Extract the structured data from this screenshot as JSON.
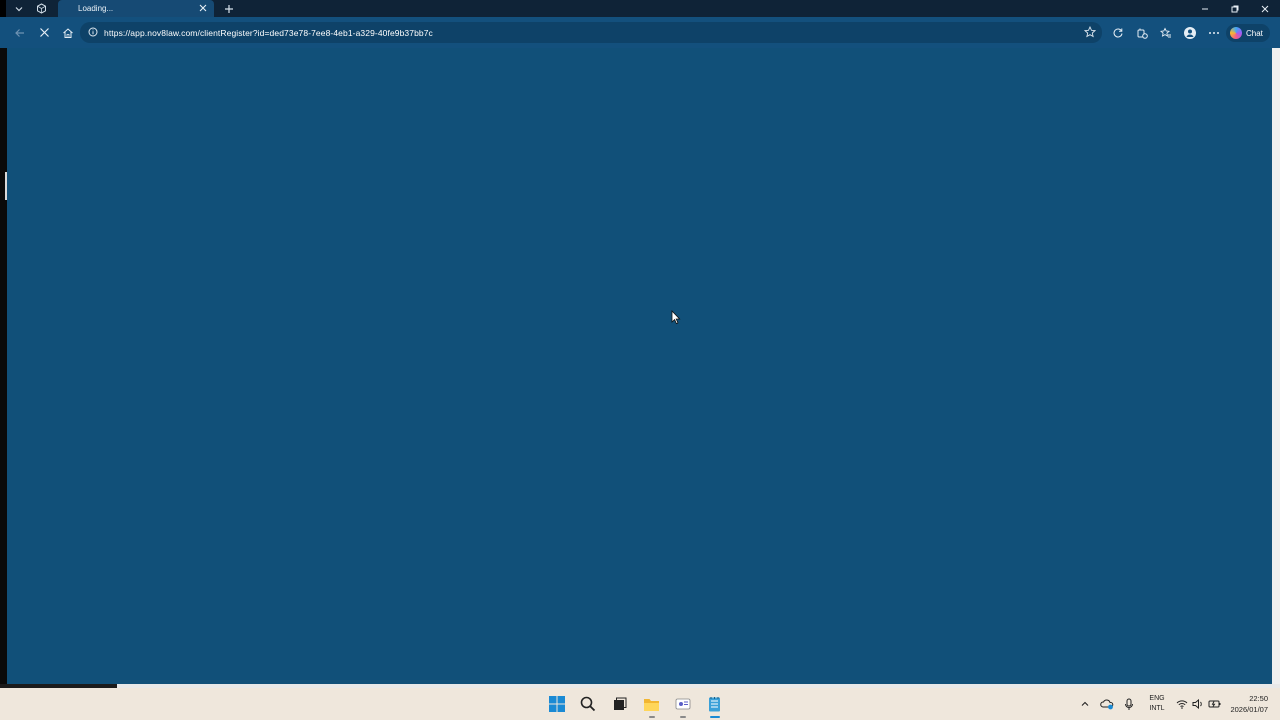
{
  "browser": {
    "tab_title": "Loading...",
    "url": "https://app.nov8law.com/clientRegister?id=ded73e78-7ee8-4eb1-a329-40fe9b37bb7c",
    "chat_label": "Chat",
    "icons": {
      "tab_actions": [
        "chevron-down-icon",
        "workspaces-icon"
      ],
      "tab_close": "close-icon",
      "new_tab": "plus-icon",
      "nav": [
        "back-icon",
        "stop-loading-icon",
        "home-icon"
      ],
      "site_info": "info-icon",
      "favorite": "star-icon",
      "toolbar": [
        "refresh-icon",
        "extensions-icon",
        "favorites-icon",
        "profile-icon",
        "more-icon"
      ],
      "window": [
        "minimize-icon",
        "restore-icon",
        "close-window-icon"
      ]
    }
  },
  "page": {
    "background_color": "#115079"
  },
  "taskbar": {
    "apps": [
      "windows-start-icon",
      "search-icon",
      "task-view-icon",
      "file-explorer-icon",
      "teams-icon",
      "notepad-icon"
    ],
    "tray": {
      "icons": [
        "chevron-up-icon",
        "onedrive-icon",
        "microphone-icon",
        "wifi-icon",
        "volume-icon",
        "battery-icon"
      ],
      "language_line1": "ENG",
      "language_line2": "INTL"
    },
    "clock": {
      "time": "22:50",
      "date": "2026/01/07"
    }
  },
  "colors": {
    "tab_strip": "#0f2337",
    "active_tab": "#164a74",
    "toolbar": "#13507d",
    "omnibox": "#0e4268",
    "taskbar": "#efe7dc"
  }
}
